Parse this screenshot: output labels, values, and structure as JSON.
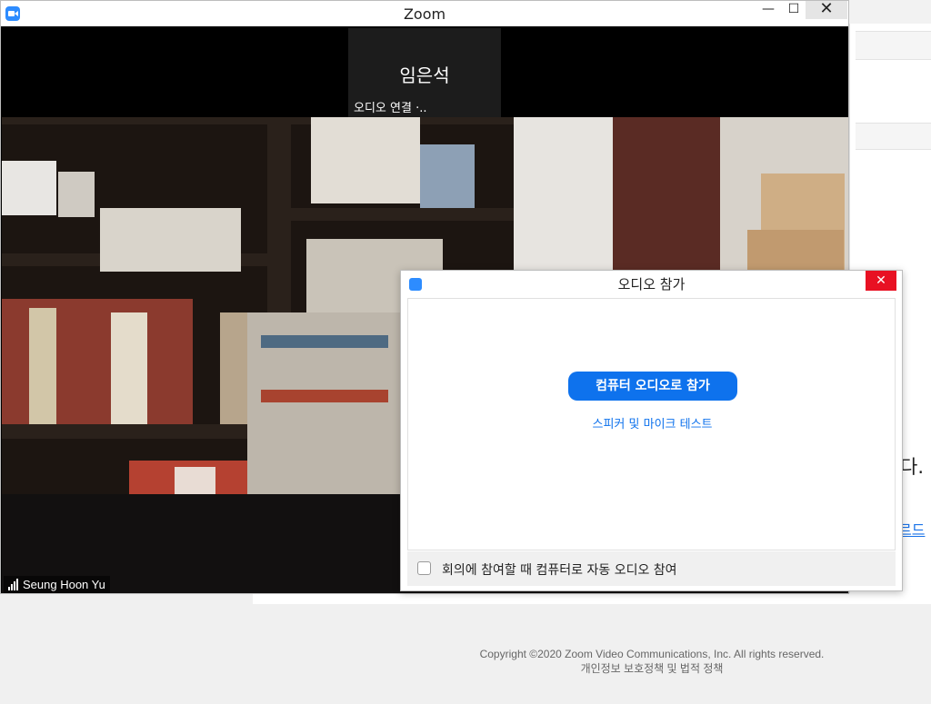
{
  "window": {
    "title": "Zoom",
    "minimize": "—",
    "maximize": "☐",
    "close": "✕"
  },
  "participant_thumb": {
    "name": "임은석",
    "status": "오디오 연결 ·.."
  },
  "video": {
    "participant_name": "Seung Hoon Yu"
  },
  "dialog": {
    "title": "오디오 참가",
    "close": "✕",
    "join_button": "컴퓨터 오디오로 참가",
    "test_link": "스피커 및 마이크 테스트",
    "auto_join_label": "회의에 참여할 때 컴퓨터로 자동 오디오 참여",
    "auto_join_checked": false
  },
  "background_page": {
    "fragment_1": "다.",
    "fragment_2": "르드",
    "copyright": "Copyright ©2020 Zoom Video Communications, Inc. All rights reserved.",
    "policy_link": "개인정보 보호정책 및 법적 정책"
  },
  "colors": {
    "accent": "#0e72ed",
    "zoom_icon": "#2d8cff",
    "close_red": "#e81123"
  }
}
